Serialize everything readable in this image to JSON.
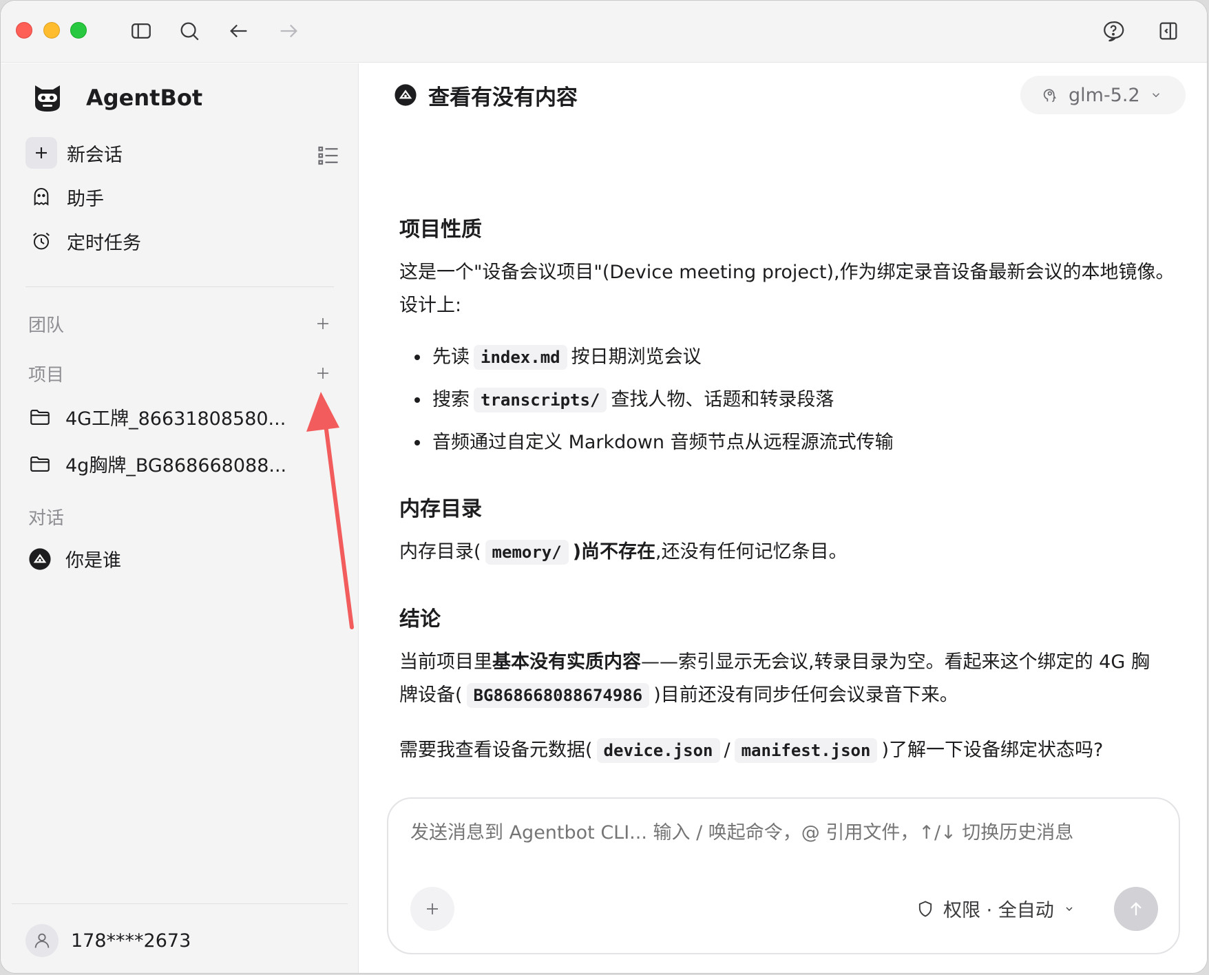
{
  "sidebar": {
    "app_name": "AgentBot",
    "new_chat": "新会话",
    "assistant": "助手",
    "scheduled": "定时任务",
    "team_label": "团队",
    "projects_label": "项目",
    "projects": [
      {
        "label": "4G工牌_86631808580..."
      },
      {
        "label": "4g胸牌_BG868668088..."
      }
    ],
    "conversations_label": "对话",
    "conversations": [
      {
        "label": "你是谁"
      }
    ],
    "user": "178****2673"
  },
  "chat": {
    "title": "查看有没有内容",
    "model": "glm-5.2"
  },
  "message": {
    "h1": "项目性质",
    "p1": "这是一个\"设备会议项目\"(Device meeting project),作为绑定录音设备最新会议的本地镜像。",
    "p1b": "设计上:",
    "bullets": [
      {
        "pre": "先读",
        "code": "index.md",
        "post": "按日期浏览会议"
      },
      {
        "pre": "搜索",
        "code": "transcripts/",
        "post": "查找人物、话题和转录段落"
      },
      {
        "pre": "音频通过自定义 Markdown 音频节点从远程源流式传输",
        "code": "",
        "post": ""
      }
    ],
    "h2": "内存目录",
    "p2_pre": "内存目录(",
    "p2_code": "memory/",
    "p2_bold": ")尚不存在",
    "p2_post": ",还没有任何记忆条目。",
    "h3": "结论",
    "p3_pre": "当前项目里",
    "p3_bold": "基本没有实质内容",
    "p3_mid": "——索引显示无会议,转录目录为空。看起来这个绑定的 4G 胸",
    "p3_line2_pre": "牌设备(",
    "p3_code": "BG868668088674986",
    "p3_post": ")目前还没有同步任何会议录音下来。",
    "p4_pre": "需要我查看设备元数据(",
    "p4_code1": "device.json",
    "p4_sep": "/",
    "p4_code2": "manifest.json",
    "p4_post": ")了解一下设备绑定状态吗?"
  },
  "composer": {
    "placeholder": "发送消息到 Agentbot CLI... 输入 / 唤起命令，@ 引用文件，↑/↓ 切换历史消息",
    "permission": "权限 · 全自动"
  },
  "icons": {
    "sidebar_toggle": "sidebar-toggle-icon",
    "search": "search-icon",
    "back": "arrow-left-icon",
    "forward": "arrow-right-icon",
    "help": "help-bubble-icon",
    "panel": "right-panel-icon"
  },
  "colors": {
    "annotation_arrow": "#f25c5c",
    "sidebar_bg": "#f4f4f5"
  }
}
